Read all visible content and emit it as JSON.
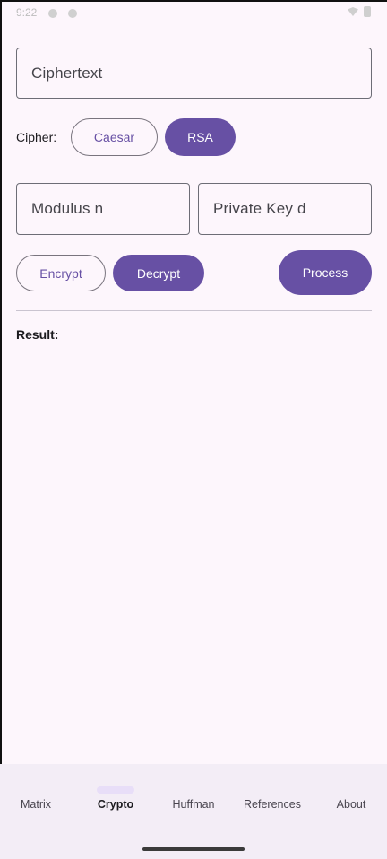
{
  "status_bar": {
    "time": "9:22"
  },
  "inputs": {
    "ciphertext_placeholder": "Ciphertext",
    "modulus_placeholder": "Modulus n",
    "private_key_placeholder": "Private Key d"
  },
  "cipher": {
    "label": "Cipher:",
    "options": [
      {
        "label": "Caesar",
        "selected": false
      },
      {
        "label": "RSA",
        "selected": true
      }
    ]
  },
  "mode": {
    "options": [
      {
        "label": "Encrypt",
        "selected": false
      },
      {
        "label": "Decrypt",
        "selected": true
      }
    ],
    "process_label": "Process"
  },
  "result": {
    "label": "Result:"
  },
  "bottom_nav": {
    "items": [
      {
        "label": "Matrix",
        "active": false
      },
      {
        "label": "Crypto",
        "active": true
      },
      {
        "label": "Huffman",
        "active": false
      },
      {
        "label": "References",
        "active": false
      },
      {
        "label": "About",
        "active": false
      }
    ]
  },
  "colors": {
    "primary": "#6750a4",
    "background": "#fdf6fc",
    "nav_background": "#f3edf6",
    "active_indicator": "#e8def8"
  }
}
